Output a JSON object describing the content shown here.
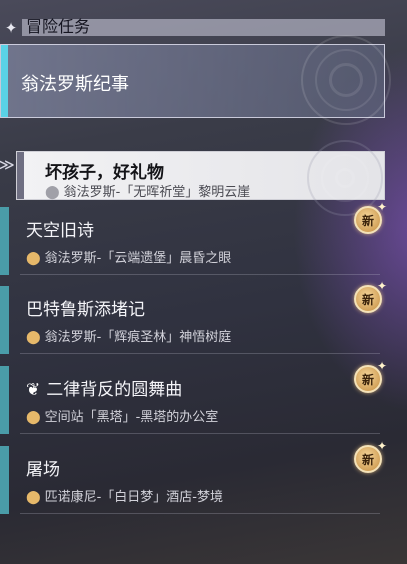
{
  "header": {
    "title": "冒险任务"
  },
  "group": {
    "label": "翁法罗斯纪事"
  },
  "selected": {
    "name": "坏孩子，好礼物",
    "location": "翁法罗斯-「无晖祈堂」黎明云崖"
  },
  "quests": [
    {
      "name": "天空旧诗",
      "location": "翁法罗斯-「云端遗堡」晨昏之眼",
      "badge": "新"
    },
    {
      "name": "巴特鲁斯添堵记",
      "location": "翁法罗斯-「辉痕圣林」神悟树庭",
      "badge": "新"
    },
    {
      "name": "二律背反的圆舞曲",
      "location": "空间站「黑塔」-黑塔的办公室",
      "badge": "新"
    },
    {
      "name": "屠场",
      "location": "匹诺康尼-「白日梦」酒店-梦境",
      "badge": "新"
    }
  ],
  "icons": {
    "header": "diamond-icon",
    "pin": "location-pin-icon",
    "new_badge": "new-badge-icon",
    "arrow": "selected-arrow-icon",
    "quest_type": "companion-quest-icon"
  },
  "colors": {
    "accent_cyan": "#5ad2e6",
    "accent_teal": "#4a9ca8",
    "badge_gold": "#c48c3e",
    "pin_gold": "#e6b86a"
  }
}
